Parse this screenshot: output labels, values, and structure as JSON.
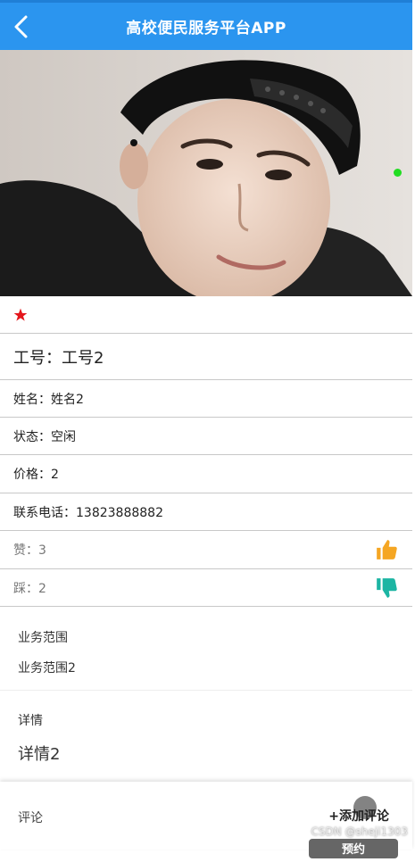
{
  "header": {
    "title": "高校便民服务平台APP"
  },
  "profile": {
    "job_number": "工号：工号2",
    "name": "姓名：姓名2",
    "status": "状态：空闲",
    "price": "价格：2",
    "phone": "联系电话：13823888882",
    "likes": "赞：3",
    "dislikes": "踩：2"
  },
  "business_scope": {
    "heading": "业务范围",
    "value": "业务范围2"
  },
  "details": {
    "heading": "详情",
    "value": "详情2"
  },
  "footer": {
    "comment_label": "评论",
    "add_comment": "+添加评论",
    "book_button": "预约"
  },
  "watermark": "CSDN @sheji1303",
  "colors": {
    "header": "#2b95ef",
    "star": "#e4161c",
    "like": "#f5a623",
    "dislike": "#1cb5a3",
    "online_dot": "#22dd22"
  }
}
